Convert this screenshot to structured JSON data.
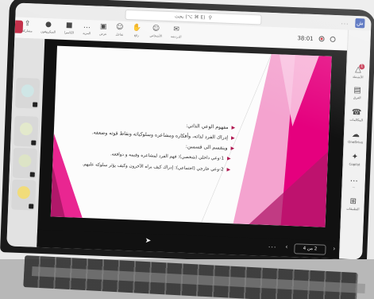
{
  "window": {
    "search_text": "بحث (⌥ ⌘ E)",
    "menu_dots": "...",
    "person_initial": "ش"
  },
  "meeting": {
    "timer": "38:01",
    "tools": [
      {
        "label": "الدردشة",
        "icon": "chat-icon"
      },
      {
        "label": "الأشخاص",
        "icon": "people-icon"
      },
      {
        "label": "رفع",
        "icon": "hand-icon"
      },
      {
        "label": "تفاعل",
        "icon": "smile-icon"
      },
      {
        "label": "عرض",
        "icon": "view-icon"
      },
      {
        "label": "المزيد",
        "icon": "more-icon"
      },
      {
        "label": "الكاميرا",
        "icon": "camera-icon"
      },
      {
        "label": "الميكروفون",
        "icon": "mic-icon"
      },
      {
        "label": "مشاركة",
        "icon": "share-icon"
      }
    ]
  },
  "rail": [
    {
      "label": "الأنشطة",
      "icon": "bell-icon",
      "badge": "1"
    },
    {
      "label": "الفرق",
      "icon": "teams-icon"
    },
    {
      "label": "المكالمات",
      "icon": "phone-icon"
    },
    {
      "label": "OneDrive",
      "icon": "cloud-icon"
    },
    {
      "label": "Copilot",
      "icon": "copilot-icon"
    },
    {
      "label": "...",
      "icon": "more-icon"
    },
    {
      "label": "التطبيقات",
      "icon": "apps-icon"
    }
  ],
  "slide": {
    "bullets": [
      {
        "text": "مفهوم الوعي الذاتي:",
        "sub": false
      },
      {
        "text": "إدراك الفرد لذاته، وأفكاره ومشاعره وسلوكياته ونقاط قوته وضعفه.",
        "sub": false
      },
      {
        "text": "وينقسم الى قسمين:",
        "sub": false
      },
      {
        "text": "1-وعي داخلي (شخصي): فهم الفرد لمشاعره وقيمه و دوافعه.",
        "sub": true
      },
      {
        "text": "2-وعي خارجي (اجتماعي): إدراك كيف يراه الآخرون وكيف يؤثر سلوكه عليهم.",
        "sub": true
      }
    ],
    "page_indicator": "2 من 4",
    "more_dots": "...",
    "colors": {
      "accent": "#e5007e",
      "accent_light": "#f4a3cf",
      "accent_dark": "#b0186a"
    }
  }
}
